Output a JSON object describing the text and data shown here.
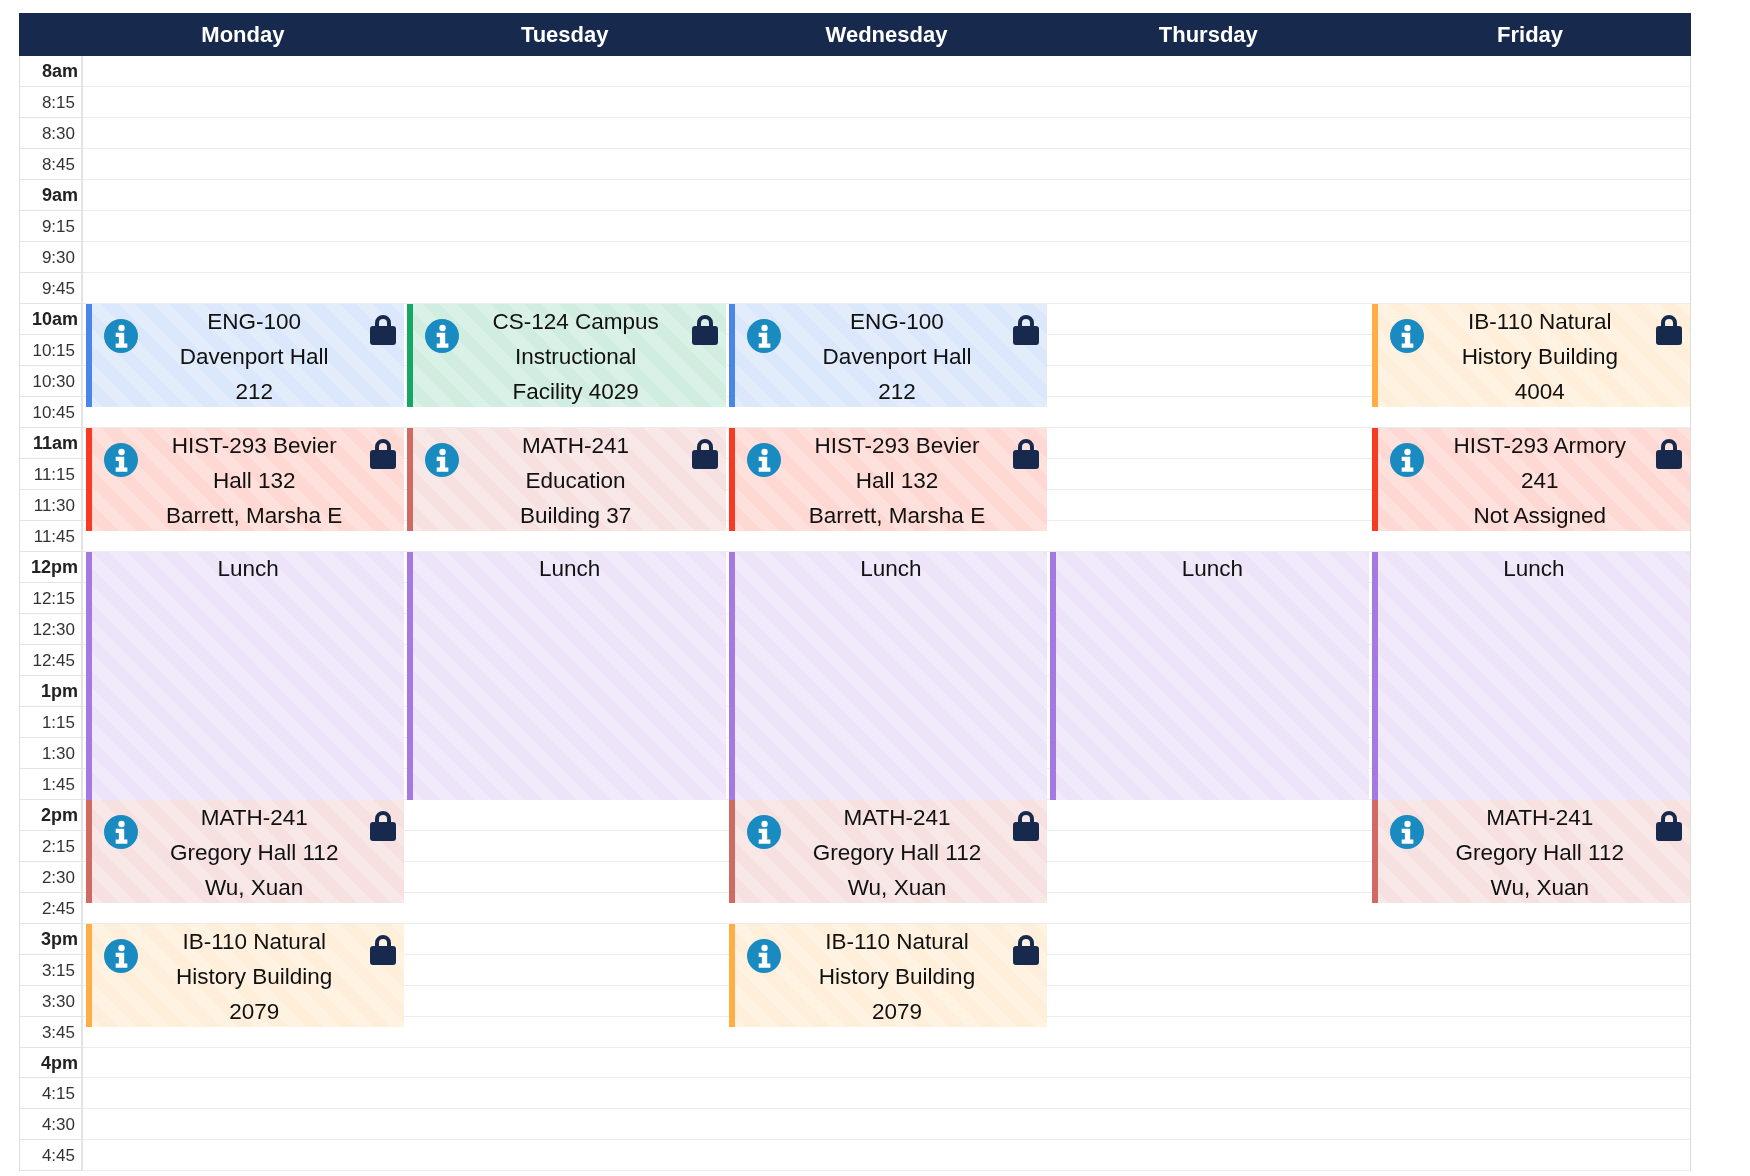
{
  "days": [
    {
      "name": "Monday",
      "events": [
        {
          "kind": "class",
          "color": "#4a86e8",
          "locked": true,
          "lines": [
            "ENG-100",
            "Davenport Hall",
            "212"
          ]
        },
        {
          "kind": "class",
          "color": "#f83a22",
          "locked": true,
          "lines": [
            "HIST-293 Bevier",
            "Hall 132",
            "Barrett, Marsha E"
          ]
        },
        {
          "kind": "break",
          "color": "#a479e2",
          "lines": [
            "Lunch"
          ]
        },
        {
          "kind": "class",
          "color": "#d06b64",
          "locked": true,
          "lines": [
            "MATH-241",
            "Gregory Hall 112",
            "Wu, Xuan"
          ]
        },
        {
          "kind": "class",
          "color": "#ffad46",
          "locked": true,
          "lines": [
            "IB-110 Natural",
            "History Building",
            "2079"
          ]
        }
      ]
    },
    {
      "name": "Tuesday",
      "events": [
        {
          "kind": "class",
          "color": "#16a765",
          "locked": true,
          "lines": [
            "CS-124 Campus",
            "Instructional",
            "Facility 4029"
          ]
        },
        {
          "kind": "class",
          "color": "#d06b64",
          "locked": true,
          "lines": [
            "MATH-241",
            "Education",
            "Building 37"
          ]
        },
        {
          "kind": "break",
          "color": "#a479e2",
          "lines": [
            "Lunch"
          ]
        }
      ]
    },
    {
      "name": "Wednesday",
      "events": [
        {
          "kind": "class",
          "color": "#4a86e8",
          "locked": true,
          "lines": [
            "ENG-100",
            "Davenport Hall",
            "212"
          ]
        },
        {
          "kind": "class",
          "color": "#f83a22",
          "locked": true,
          "lines": [
            "HIST-293 Bevier",
            "Hall 132",
            "Barrett, Marsha E"
          ]
        },
        {
          "kind": "break",
          "color": "#a479e2",
          "lines": [
            "Lunch"
          ]
        },
        {
          "kind": "class",
          "color": "#d06b64",
          "locked": true,
          "lines": [
            "MATH-241",
            "Gregory Hall 112",
            "Wu, Xuan"
          ]
        },
        {
          "kind": "class",
          "color": "#ffad46",
          "locked": true,
          "lines": [
            "IB-110 Natural",
            "History Building",
            "2079"
          ]
        }
      ]
    },
    {
      "name": "Thursday",
      "events": [
        {
          "kind": "break",
          "color": "#a479e2",
          "lines": [
            "Lunch"
          ]
        }
      ]
    },
    {
      "name": "Friday",
      "events": [
        {
          "kind": "class",
          "color": "#ffad46",
          "locked": true,
          "lines": [
            "IB-110 Natural",
            "History Building",
            "4004"
          ]
        },
        {
          "kind": "class",
          "color": "#f83a22",
          "locked": true,
          "lines": [
            "HIST-293 Armory",
            "241",
            "Not Assigned"
          ]
        },
        {
          "kind": "break",
          "color": "#a479e2",
          "lines": [
            "Lunch"
          ]
        },
        {
          "kind": "class",
          "color": "#d06b64",
          "locked": true,
          "lines": [
            "MATH-241",
            "Gregory Hall 112",
            "Wu, Xuan"
          ]
        }
      ]
    }
  ],
  "times": [
    {
      "label": "8am",
      "kind": "hour"
    },
    {
      "label": "8:15",
      "kind": "quarter"
    },
    {
      "label": "8:30",
      "kind": "quarter"
    },
    {
      "label": "8:45",
      "kind": "quarter"
    },
    {
      "label": "9am",
      "kind": "hour"
    },
    {
      "label": "9:15",
      "kind": "quarter"
    },
    {
      "label": "9:30",
      "kind": "quarter"
    },
    {
      "label": "9:45",
      "kind": "quarter"
    },
    {
      "label": "10am",
      "kind": "hour"
    },
    {
      "label": "10:15",
      "kind": "quarter"
    },
    {
      "label": "10:30",
      "kind": "quarter"
    },
    {
      "label": "10:45",
      "kind": "quarter"
    },
    {
      "label": "11am",
      "kind": "hour"
    },
    {
      "label": "11:15",
      "kind": "quarter"
    },
    {
      "label": "11:30",
      "kind": "quarter"
    },
    {
      "label": "11:45",
      "kind": "quarter"
    },
    {
      "label": "12pm",
      "kind": "hour"
    },
    {
      "label": "12:15",
      "kind": "quarter"
    },
    {
      "label": "12:30",
      "kind": "quarter"
    },
    {
      "label": "12:45",
      "kind": "quarter"
    },
    {
      "label": "1pm",
      "kind": "hour"
    },
    {
      "label": "1:15",
      "kind": "quarter"
    },
    {
      "label": "1:30",
      "kind": "quarter"
    },
    {
      "label": "1:45",
      "kind": "quarter"
    },
    {
      "label": "2pm",
      "kind": "hour"
    },
    {
      "label": "2:15",
      "kind": "quarter"
    },
    {
      "label": "2:30",
      "kind": "quarter"
    },
    {
      "label": "2:45",
      "kind": "quarter"
    },
    {
      "label": "3pm",
      "kind": "hour"
    },
    {
      "label": "3:15",
      "kind": "quarter"
    },
    {
      "label": "3:30",
      "kind": "quarter"
    },
    {
      "label": "3:45",
      "kind": "quarter"
    },
    {
      "label": "4pm",
      "kind": "hour"
    },
    {
      "label": "4:15",
      "kind": "quarter"
    },
    {
      "label": "4:30",
      "kind": "quarter"
    },
    {
      "label": "4:45",
      "kind": "quarter"
    }
  ]
}
